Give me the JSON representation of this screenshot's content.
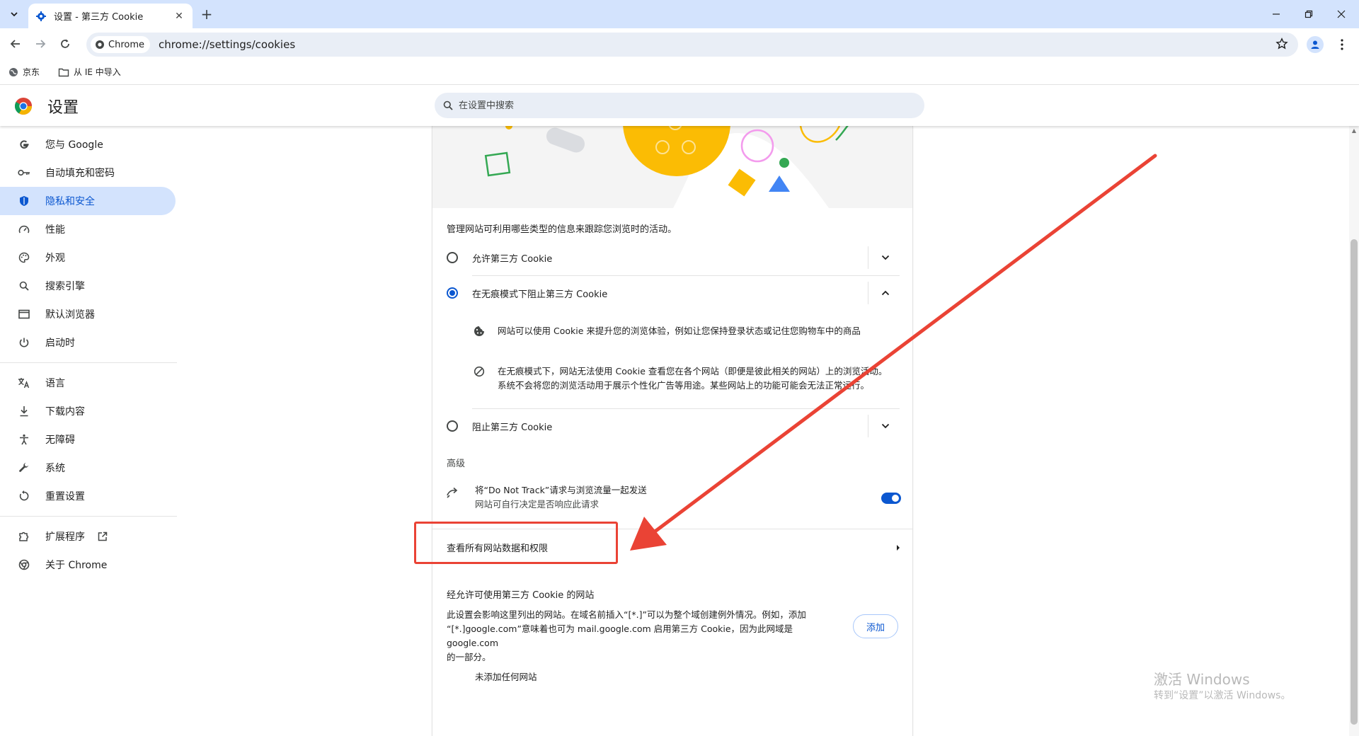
{
  "browser": {
    "tab_title": "设置 - 第三方 Cookie",
    "url_chip": "Chrome",
    "url": "chrome://settings/cookies",
    "bookmarks": [
      "京东",
      "从 IE 中导入"
    ]
  },
  "header": {
    "title": "设置",
    "search_placeholder": "在设置中搜索"
  },
  "sidebar": {
    "items": [
      {
        "label": "您与 Google",
        "icon": "google-icon"
      },
      {
        "label": "自动填充和密码",
        "icon": "key-icon"
      },
      {
        "label": "隐私和安全",
        "icon": "shield-icon"
      },
      {
        "label": "性能",
        "icon": "speedometer-icon"
      },
      {
        "label": "外观",
        "icon": "palette-icon"
      },
      {
        "label": "搜索引擎",
        "icon": "search-icon"
      },
      {
        "label": "默认浏览器",
        "icon": "browser-window-icon"
      },
      {
        "label": "启动时",
        "icon": "power-icon"
      },
      {
        "label": "语言",
        "icon": "translate-icon"
      },
      {
        "label": "下载内容",
        "icon": "download-icon"
      },
      {
        "label": "无障碍",
        "icon": "accessibility-icon"
      },
      {
        "label": "系统",
        "icon": "wrench-icon"
      },
      {
        "label": "重置设置",
        "icon": "reset-icon"
      },
      {
        "label": "扩展程序",
        "icon": "puzzle-icon"
      },
      {
        "label": "关于 Chrome",
        "icon": "chrome-icon"
      }
    ]
  },
  "cookies": {
    "section_desc": "管理网站可利用哪些类型的信息来跟踪您浏览时的活动。",
    "option_allow": "允许第三方 Cookie",
    "option_block_incognito": "在无痕模式下阻止第三方 Cookie",
    "detail_1": "网站可以使用 Cookie 来提升您的浏览体验，例如让您保持登录状态或记住您购物车中的商品",
    "detail_2_line1": "在无痕模式下，网站无法使用 Cookie 查看您在各个网站（即便是彼此相关的网站）上的浏览活动。",
    "detail_2_line2": "系统不会将您的浏览活动用于展示个性化广告等用途。某些网站上的功能可能会无法正常运行。",
    "option_block": "阻止第三方 Cookie",
    "advanced_heading": "高级",
    "dnt_title": "将“Do Not Track”请求与浏览流量一起发送",
    "dnt_subtitle": "网站可自行决定是否响应此请求",
    "dnt_enabled": true,
    "view_all_link": "查看所有网站数据和权限",
    "allowed_heading": "经允许可使用第三方 Cookie 的网站",
    "allowed_desc_line1": "此设置会影响这里列出的网站。在域名前插入“[*.]”可以为整个域创建例外情况。例如，添加",
    "allowed_desc_line2": "“[*.]google.com”意味着也可为 mail.google.com 启用第三方 Cookie，因为此网域是 google.com",
    "allowed_desc_line3": "的一部分。",
    "add_button": "添加",
    "empty_list": "未添加任何网站"
  },
  "watermark": {
    "line1": "激活 Windows",
    "line2": "转到“设置”以激活 Windows。"
  },
  "colors": {
    "accent": "#0b57d0",
    "annotation": "#ea4335",
    "tabbar": "#d3e3fd"
  }
}
